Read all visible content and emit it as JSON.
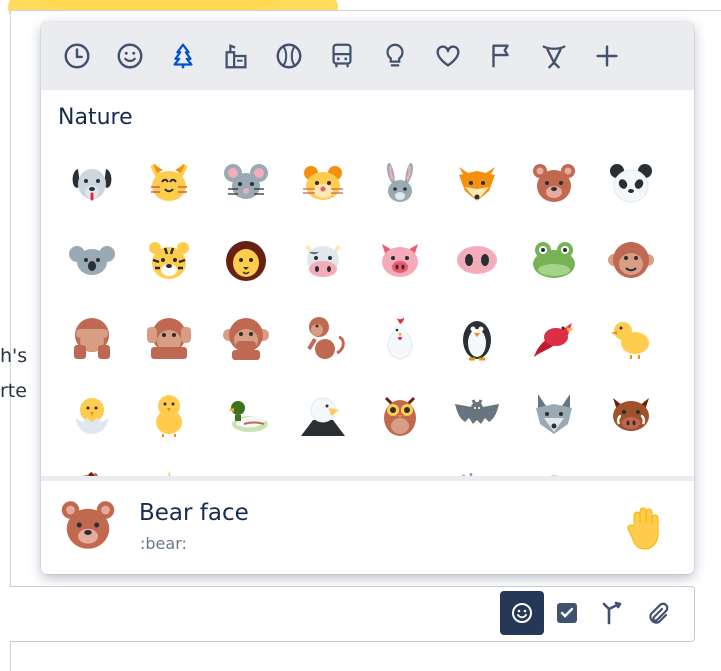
{
  "background": {
    "text_lines": [
      "h's",
      "rte"
    ]
  },
  "picker": {
    "categories": [
      {
        "name": "frequent",
        "icon": "clock-icon",
        "active": false
      },
      {
        "name": "people",
        "icon": "smiley-icon",
        "active": false
      },
      {
        "name": "nature",
        "icon": "tree-icon",
        "active": true
      },
      {
        "name": "foods",
        "icon": "food-icon",
        "active": false
      },
      {
        "name": "activity",
        "icon": "ball-icon",
        "active": false
      },
      {
        "name": "travel",
        "icon": "bus-icon",
        "active": false
      },
      {
        "name": "objects",
        "icon": "lightbulb-icon",
        "active": false
      },
      {
        "name": "symbols",
        "icon": "heart-icon",
        "active": false
      },
      {
        "name": "flags",
        "icon": "flag-icon",
        "active": false
      },
      {
        "name": "productivity",
        "icon": "atlassian-icon",
        "active": false
      },
      {
        "name": "add",
        "icon": "plus-icon",
        "active": false
      }
    ],
    "section_title": "Nature",
    "emoji_rows": [
      [
        "dog-icon",
        "cat-icon",
        "mouse-icon",
        "hamster-icon",
        "rabbit-icon",
        "fox-icon",
        "bear-icon",
        "panda-icon"
      ],
      [
        "koala-icon",
        "tiger-icon",
        "lion-icon",
        "cow-icon",
        "pig-icon",
        "pig-nose-icon",
        "frog-icon",
        "monkey-face-icon"
      ],
      [
        "see-no-evil-icon",
        "hear-no-evil-icon",
        "speak-no-evil-icon",
        "monkey-icon",
        "chicken-icon",
        "penguin-icon",
        "bird-icon",
        "baby-chick-icon"
      ],
      [
        "hatching-chick-icon",
        "hatched-chick-icon",
        "duck-icon",
        "eagle-icon",
        "owl-icon",
        "bat-icon",
        "wolf-icon",
        "boar-icon"
      ],
      [
        "horse-icon",
        "unicorn-icon",
        "bee-icon",
        "bug-icon",
        "butterfly-icon",
        "snail-icon",
        "shell-icon",
        "beetle-icon"
      ]
    ],
    "preview": {
      "name": "Bear face",
      "shortcode": ":bear:",
      "icon": "bear-icon",
      "skin_tone_icon": "raised-hand-icon"
    }
  },
  "toolbar": {
    "tools": [
      {
        "icon": "emoji-icon",
        "active": true
      },
      {
        "icon": "checkbox-icon",
        "active": false
      },
      {
        "icon": "decision-icon",
        "active": false
      },
      {
        "icon": "attachment-icon",
        "active": false
      }
    ]
  },
  "colors": {
    "accent": "#0052cc",
    "icon_gray": "#42526e",
    "active_tool": "#253858"
  }
}
